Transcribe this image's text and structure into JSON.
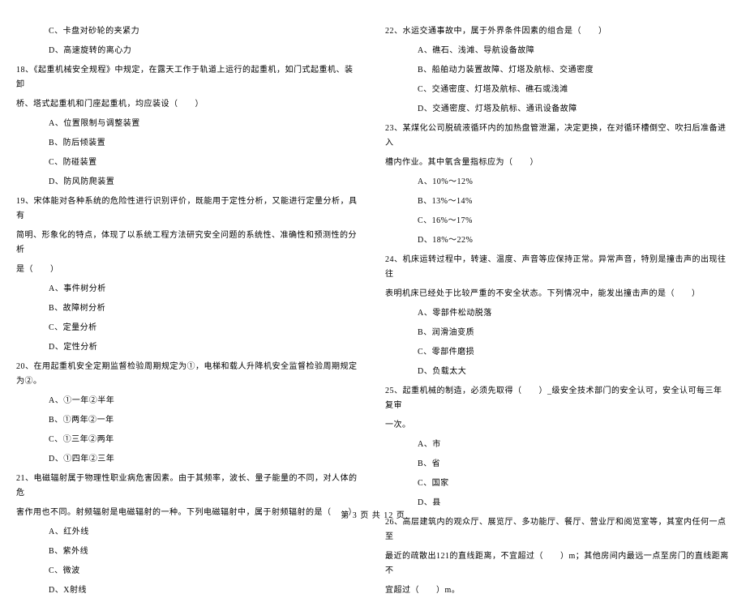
{
  "left_column": {
    "q17_options": [
      "C、卡盘对砂轮的夹紧力",
      "D、高速旋转的离心力"
    ],
    "q18": {
      "text_l1": "18、《起重机械安全规程》中规定，在露天工作于轨道上运行的起重机，如门式起重机、装卸",
      "text_l2": "桥、塔式起重机和门座起重机，均应装设（　　）",
      "options": [
        "A、位置限制与调整装置",
        "B、防后倾装置",
        "C、防碰装置",
        "D、防风防爬装置"
      ]
    },
    "q19": {
      "text_l1": "19、宋体能对各种系统的危险性进行识别评价，既能用于定性分析，又能进行定量分析，具有",
      "text_l2": "简明、形象化的特点，体现了以系统工程方法研究安全问题的系统性、准确性和预测性的分析",
      "text_l3": "是（　　）",
      "options": [
        "A、事件树分析",
        "B、故障树分析",
        "C、定量分析",
        "D、定性分析"
      ]
    },
    "q20": {
      "text": "20、在用起重机安全定期监督检验周期规定为①，电梯和载人升降机安全监督检验周期规定为②。",
      "options": [
        "A、①一年②半年",
        "B、①两年②一年",
        "C、①三年②两年",
        "D、①四年②三年"
      ]
    },
    "q21": {
      "text_l1": "21、电磁辐射属于物理性职业病危害因素。由于其频率，波长、量子能量的不同，对人体的危",
      "text_l2": "害作用也不同。射频辐射是电磁辐射的一种。下列电磁辐射中，属于射频辐射的是（　　）",
      "options": [
        "A、红外线",
        "B、紫外线",
        "C、微波",
        "D、X射线"
      ]
    }
  },
  "right_column": {
    "q22": {
      "text": "22、水运交通事故中，属于外界条件因素的组合是（　　）",
      "options": [
        "A、礁石、浅滩、导航设备故障",
        "B、船舶动力装置故障、灯塔及航标、交通密度",
        "C、交通密度、灯塔及航标、礁石或浅滩",
        "D、交通密度、灯塔及航标、通讯设备故障"
      ]
    },
    "q23": {
      "text_l1": "23、某煤化公司脱硫液循环内的加热盘管泄漏，决定更换，在对循环槽倒空、吹扫后准备进入",
      "text_l2": "槽内作业。其中氧含量指标应为（　　）",
      "options": [
        "A、10%～12%",
        "B、13%～14%",
        "C、16%～17%",
        "D、18%～22%"
      ]
    },
    "q24": {
      "text_l1": "24、机床运转过程中，转速、温度、声音等应保持正常。异常声音，特别是撞击声的出现往往",
      "text_l2": "表明机床已经处于比较严重的不安全状态。下列情况中，能发出撞击声的是（　　）",
      "options": [
        "A、零部件松动脱落",
        "B、润滑油变质",
        "C、零部件磨损",
        "D、负载太大"
      ]
    },
    "q25": {
      "text_l1": "25、起重机械的制造，必须先取得（　　）_级安全技术部门的安全认可，安全认可每三年复审",
      "text_l2": "一次。",
      "options": [
        "A、市",
        "B、省",
        "C、国家",
        "D、县"
      ]
    },
    "q26": {
      "text_l1": "26、高层建筑内的观众厅、展览厅、多功能厅、餐厅、营业厅和阅览室等，其室内任何一点至",
      "text_l2": "最近的疏散出121的直线距离，不宜超过（　　）m；其他房间内最远一点至房门的直线距离不",
      "text_l3": "宜超过（　　）m。"
    }
  },
  "footer": "第 3 页 共 12 页"
}
